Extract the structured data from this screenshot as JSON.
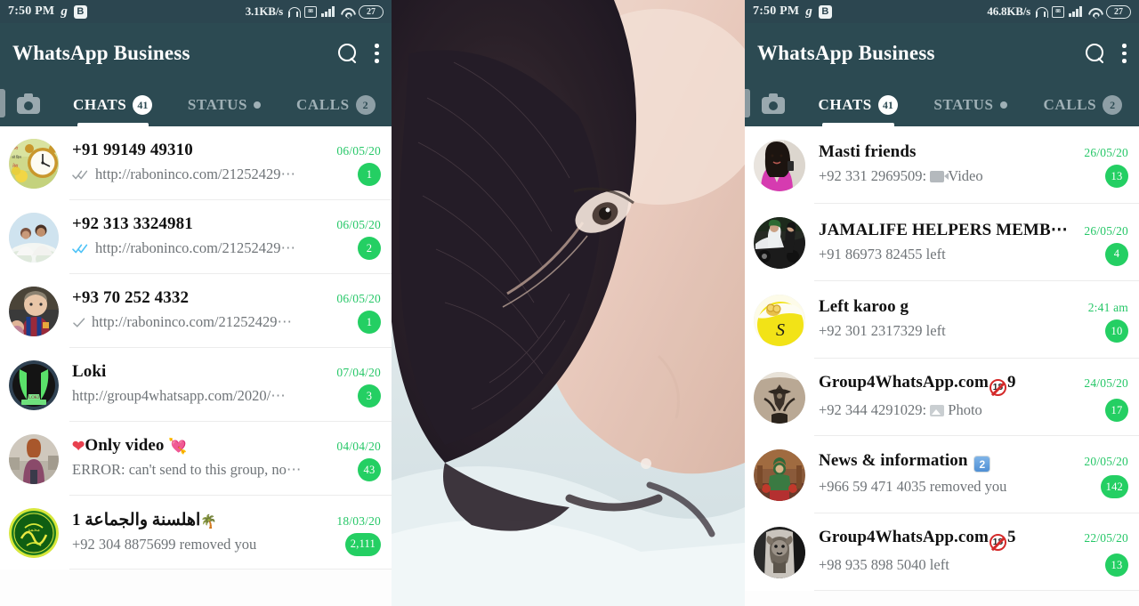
{
  "app": {
    "title": "WhatsApp Business",
    "accent_green": "#24cf63",
    "header_bg": "#2c4a52",
    "statusbar_bg": "#2c4650",
    "time_green": "#25c767"
  },
  "left_phone": {
    "statusbar": {
      "time": "7:50 PM",
      "g_icon": "g",
      "b_icon": "B",
      "data_rate": "3.1KB/s",
      "battery": "27",
      "icons": [
        "headphone-icon",
        "sim-card-icon",
        "signal-bars-icon",
        "wifi-icon",
        "battery-icon"
      ]
    },
    "appbar": {
      "title": "WhatsApp Business",
      "search_icon": "search-icon",
      "overflow_icon": "more-vertical-icon"
    },
    "tabs": {
      "camera_icon": "camera-icon",
      "items": [
        {
          "label": "CHATS",
          "badge": "41",
          "badge_style": "white",
          "active": true
        },
        {
          "label": "STATUS",
          "badge": "",
          "badge_style": "dot",
          "active": false
        },
        {
          "label": "CALLS",
          "badge": "2",
          "badge_style": "grey",
          "active": false
        }
      ]
    },
    "chats": [
      {
        "name": "+91 99149 49310",
        "time": "06/05/20",
        "ticks": "double-grey",
        "message": "http://raboninco.com/21252429",
        "truncated": true,
        "unread": "1",
        "avatar": "clock-poster"
      },
      {
        "name": "+92 313 3324981",
        "time": "06/05/20",
        "ticks": "double-blue",
        "message": "http://raboninco.com/21252429",
        "truncated": true,
        "unread": "2",
        "avatar": "couple-photo"
      },
      {
        "name": "+93 70 252 4332",
        "time": "06/05/20",
        "ticks": "single-grey",
        "message": "http://raboninco.com/21252429",
        "truncated": true,
        "unread": "1",
        "avatar": "child-jersey"
      },
      {
        "name": "Loki",
        "time": "07/04/20",
        "ticks": "none",
        "message": "http://group4whatsapp.com/2020/",
        "truncated": true,
        "unread": "3",
        "avatar": "green-logo"
      },
      {
        "name": "Only video",
        "name_prefix_emoji": "heart",
        "name_suffix_emoji": "heart-arrow",
        "time": "04/04/20",
        "ticks": "none",
        "message": "ERROR: can't send to this group, no",
        "truncated": true,
        "unread": "43",
        "avatar": "woman-street"
      },
      {
        "name": "1 اهلسنة والجماعة",
        "name_has_palms": true,
        "time": "18/03/20",
        "ticks": "none",
        "message": "+92 304 8875699 removed you",
        "truncated": false,
        "unread": "2,111",
        "avatar": "green-calligraphy"
      }
    ]
  },
  "right_phone": {
    "statusbar": {
      "time": "7:50 PM",
      "g_icon": "g",
      "b_icon": "B",
      "data_rate": "46.8KB/s",
      "battery": "27",
      "icons": [
        "headphone-icon",
        "sim-card-icon",
        "signal-bars-icon",
        "wifi-icon",
        "battery-icon"
      ]
    },
    "appbar": {
      "title": "WhatsApp Business",
      "search_icon": "search-icon",
      "overflow_icon": "more-vertical-icon"
    },
    "tabs": {
      "camera_icon": "camera-icon",
      "items": [
        {
          "label": "CHATS",
          "badge": "41",
          "badge_style": "white",
          "active": true
        },
        {
          "label": "STATUS",
          "badge": "",
          "badge_style": "dot",
          "active": false
        },
        {
          "label": "CALLS",
          "badge": "2",
          "badge_style": "grey",
          "active": false
        }
      ]
    },
    "chats": [
      {
        "name": "Masti friends",
        "time": "26/05/20",
        "message_prefix": "+92 331 2969509:",
        "message_icon": "video-icon",
        "message_suffix": "Video",
        "unread": "13",
        "avatar": "woman-pink"
      },
      {
        "name": "JAMALIFE HELPERS MEMB",
        "truncated_name": true,
        "time": "26/05/20",
        "message_prefix": "+91 86973 82455 left",
        "unread": "4",
        "avatar": "car-couple"
      },
      {
        "name": "Left karoo g",
        "time": "2:41 am",
        "message_prefix": "+92 301 2317329 left",
        "unread": "10",
        "avatar": "yellow-ring"
      },
      {
        "name_before": "Group4WhatsApp.com",
        "name_emoji": "18",
        "name_after": "9",
        "time": "24/05/20",
        "message_prefix": "+92 344 4291029:",
        "message_icon": "photo-icon",
        "message_suffix": "Photo",
        "unread": "17",
        "avatar": "tattoo-back"
      },
      {
        "name_before": "News & information",
        "name_emoji": "2",
        "name_after": "",
        "time": "20/05/20",
        "message_prefix": "+966 59 471 4035 removed you",
        "unread": "142",
        "avatar": "deity-photo"
      },
      {
        "name_before": "Group4WhatsApp.com",
        "name_emoji": "18",
        "name_after": "5",
        "time": "22/05/20",
        "message_prefix": "+98 935 898 5040 left",
        "unread": "13",
        "avatar": "lion-tattoo"
      }
    ]
  },
  "center_photo": {
    "description": "close-up portrait of a person with dark hair lying down",
    "name": "center-photo"
  }
}
